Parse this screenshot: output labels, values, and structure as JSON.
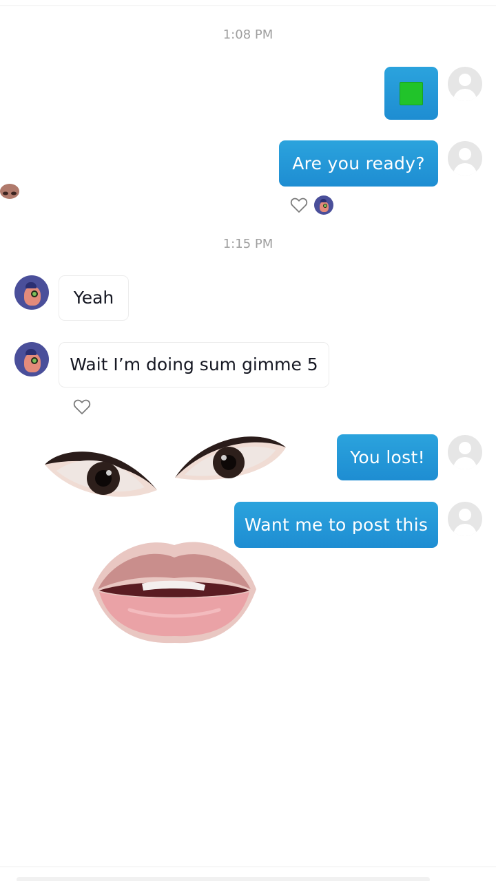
{
  "chat": {
    "timestamp_1": "1:08 PM",
    "timestamp_2": "1:15 PM",
    "messages": [
      {
        "sender": "me",
        "content": "green-square-emoji"
      },
      {
        "sender": "me",
        "text": "Are you ready?"
      },
      {
        "sender": "them",
        "text": "Yeah"
      },
      {
        "sender": "them",
        "text": "Wait I’m doing sum gimme 5"
      },
      {
        "sender": "me",
        "text": "You lost!"
      },
      {
        "sender": "me",
        "text": "Want me to post this"
      }
    ]
  },
  "icons": {
    "like": "heart-outline-icon",
    "default_avatar": "default-user-avatar-icon",
    "contact_avatar": "cartoon-avatar-icon",
    "emoji": "green-square-emoji-icon"
  },
  "colors": {
    "sent_bubble": "#2196d8",
    "received_bubble_border": "#ececec",
    "timestamp_text": "#9e9e9e",
    "emoji_green": "#21c32a"
  }
}
